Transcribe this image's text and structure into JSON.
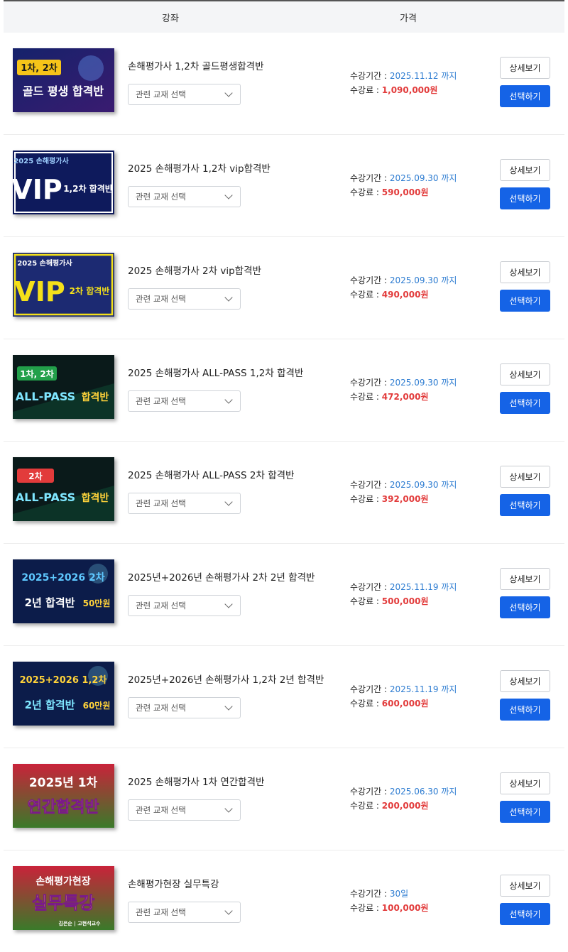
{
  "header": {
    "course_col": "강좌",
    "price_col": "가격"
  },
  "rows": [
    {
      "thumb": {
        "badge": "1차, 2차",
        "line1": "",
        "line2": "골드 평생 합격반",
        "extra": ""
      },
      "title": "손해평가사 1,2차 골드평생합격반",
      "select_placeholder": "관련 교재 선택",
      "period_label": "수강기간 : ",
      "period_value": "2025.11.12 까지",
      "fee_label": "수강료 : ",
      "fee_value": "1,090,000원",
      "detail_button": "상세보기",
      "select_button": "선택하기"
    },
    {
      "thumb": {
        "badge": "",
        "line1": "2025 손해평가사",
        "line2": "VIP",
        "extra": "1,2차 합격반"
      },
      "title": "2025 손해평가사 1,2차 vip합격반",
      "select_placeholder": "관련 교재 선택",
      "period_label": "수강기간 : ",
      "period_value": "2025.09.30 까지",
      "fee_label": "수강료 : ",
      "fee_value": "590,000원",
      "detail_button": "상세보기",
      "select_button": "선택하기"
    },
    {
      "thumb": {
        "badge": "",
        "line1": "2025 손해평가사",
        "line2": "VIP",
        "extra": "2차 합격반"
      },
      "title": "2025 손해평가사 2차 vip합격반",
      "select_placeholder": "관련 교재 선택",
      "period_label": "수강기간 : ",
      "period_value": "2025.09.30 까지",
      "fee_label": "수강료 : ",
      "fee_value": "490,000원",
      "detail_button": "상세보기",
      "select_button": "선택하기"
    },
    {
      "thumb": {
        "badge": "1차, 2차",
        "line1": "",
        "line2": "ALL-PASS",
        "extra": "합격반"
      },
      "title": "2025 손해평가사 ALL-PASS 1,2차 합격반",
      "select_placeholder": "관련 교재 선택",
      "period_label": "수강기간 : ",
      "period_value": "2025.09.30 까지",
      "fee_label": "수강료 : ",
      "fee_value": "472,000원",
      "detail_button": "상세보기",
      "select_button": "선택하기"
    },
    {
      "thumb": {
        "badge": "2차",
        "line1": "",
        "line2": "ALL-PASS",
        "extra": "합격반"
      },
      "title": "2025 손해평가사 ALL-PASS 2차 합격반",
      "select_placeholder": "관련 교재 선택",
      "period_label": "수강기간 : ",
      "period_value": "2025.09.30 까지",
      "fee_label": "수강료 : ",
      "fee_value": "392,000원",
      "detail_button": "상세보기",
      "select_button": "선택하기"
    },
    {
      "thumb": {
        "badge": "",
        "line1": "2025+2026 2차",
        "line2": "2년 합격반",
        "extra": "50만원"
      },
      "title": "2025년+2026년 손해평가사 2차 2년 합격반",
      "select_placeholder": "관련 교재 선택",
      "period_label": "수강기간 : ",
      "period_value": "2025.11.19 까지",
      "fee_label": "수강료 : ",
      "fee_value": "500,000원",
      "detail_button": "상세보기",
      "select_button": "선택하기"
    },
    {
      "thumb": {
        "badge": "",
        "line1": "2025+2026 1,2차",
        "line2": "2년 합격반",
        "extra": "60만원"
      },
      "title": "2025년+2026년 손해평가사 1,2차 2년 합격반",
      "select_placeholder": "관련 교재 선택",
      "period_label": "수강기간 : ",
      "period_value": "2025.11.19 까지",
      "fee_label": "수강료 : ",
      "fee_value": "600,000원",
      "detail_button": "상세보기",
      "select_button": "선택하기"
    },
    {
      "thumb": {
        "badge": "",
        "line1": "2025년 1차",
        "line2": "연간합격반",
        "extra": ""
      },
      "title": "2025 손해평가사 1차 연간합격반",
      "select_placeholder": "관련 교재 선택",
      "period_label": "수강기간 : ",
      "period_value": "2025.06.30 까지",
      "fee_label": "수강료 : ",
      "fee_value": "200,000원",
      "detail_button": "상세보기",
      "select_button": "선택하기"
    },
    {
      "thumb": {
        "badge": "",
        "line1": "손해평가현장",
        "line2": "실무특강",
        "extra": "김은순 | 고현석교수"
      },
      "title": "손해평가현장 실무특강",
      "select_placeholder": "관련 교재 선택",
      "period_label": "수강기간 : ",
      "period_value": "30일",
      "fee_label": "수강료 : ",
      "fee_value": "100,000원",
      "detail_button": "상세보기",
      "select_button": "선택하기"
    }
  ]
}
